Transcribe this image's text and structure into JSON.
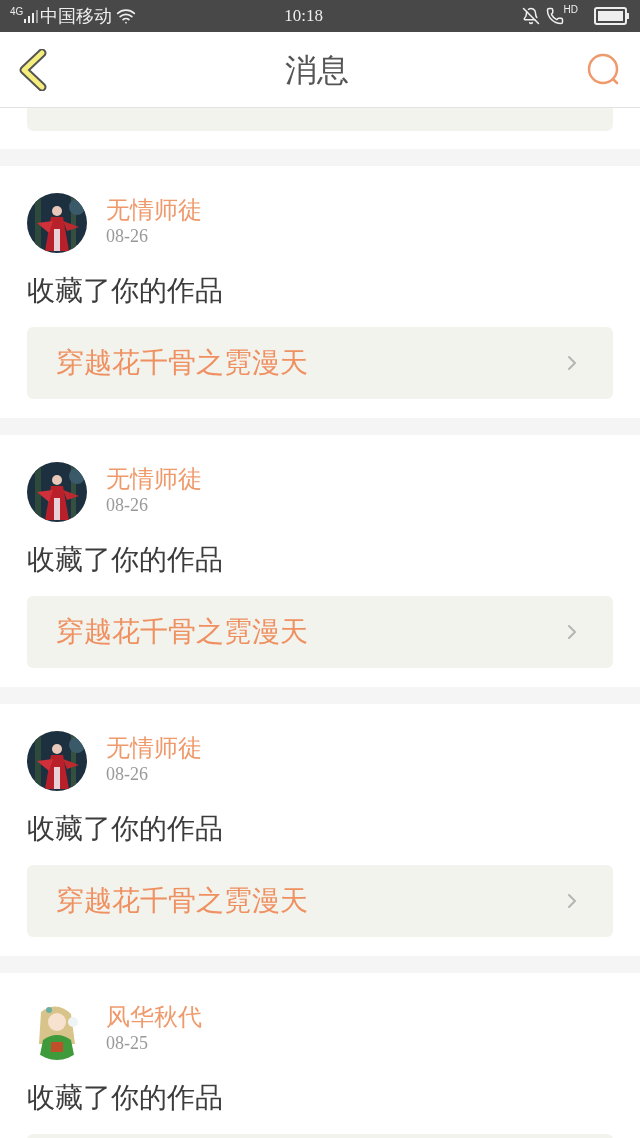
{
  "status_bar": {
    "network": "4G",
    "carrier": "中国移动",
    "time": "10:18",
    "call_badge": "HD"
  },
  "header": {
    "title": "消息"
  },
  "messages": [
    {
      "user": "无情师徒",
      "date": "08-26",
      "text": "收藏了你的作品",
      "work": "穿越花千骨之霓漫天"
    },
    {
      "user": "无情师徒",
      "date": "08-26",
      "text": "收藏了你的作品",
      "work": "穿越花千骨之霓漫天"
    },
    {
      "user": "无情师徒",
      "date": "08-26",
      "text": "收藏了你的作品",
      "work": "穿越花千骨之霓漫天"
    },
    {
      "user": "风华秋代",
      "date": "08-25",
      "text": "收藏了你的作品"
    }
  ]
}
